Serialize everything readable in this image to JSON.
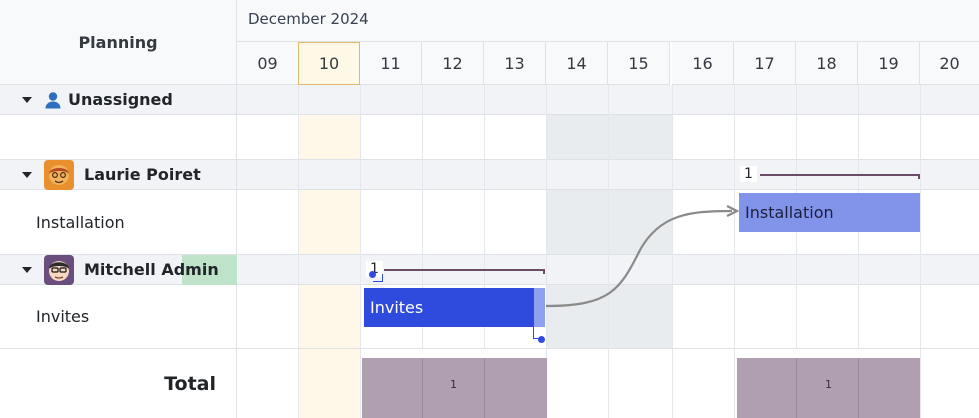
{
  "header": {
    "left_title": "Planning",
    "month": "December 2024",
    "days": [
      "09",
      "10",
      "11",
      "12",
      "13",
      "14",
      "15",
      "16",
      "17",
      "18",
      "19",
      "20"
    ],
    "today": "10"
  },
  "groups": {
    "unassigned": {
      "label": "Unassigned",
      "icon": "user-icon"
    },
    "laurie": {
      "label": "Laurie Poiret",
      "counter": "1",
      "task": {
        "label": "Installation",
        "pill": "Installation",
        "color": "#8194ea"
      }
    },
    "mitchell": {
      "label": "Mitchell Admin",
      "counter": "1",
      "task": {
        "label": "Invites",
        "pill": "Invites",
        "color": "#2f4bdd"
      }
    }
  },
  "total": {
    "label": "Total",
    "values": [
      "1",
      "1"
    ],
    "color": "#b09fb1"
  }
}
